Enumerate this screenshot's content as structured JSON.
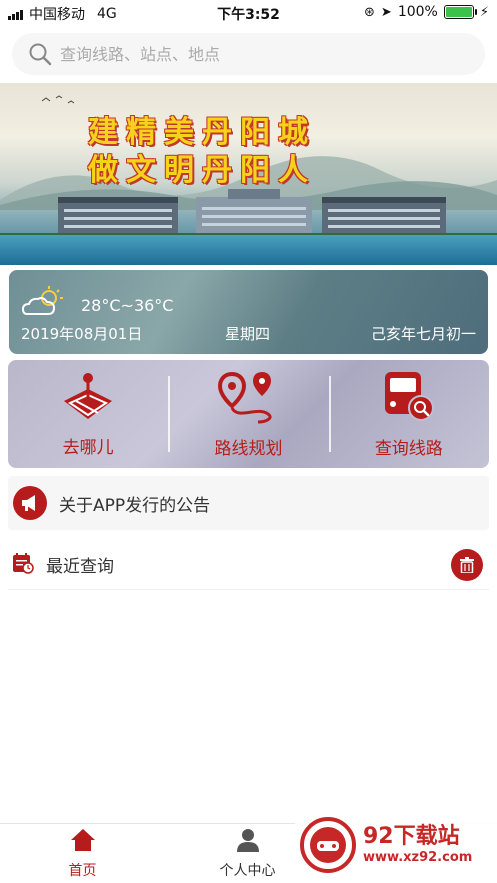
{
  "status_bar": {
    "carrier": "中国移动",
    "network": "4G",
    "time": "下午3:52",
    "battery": "100%"
  },
  "search": {
    "placeholder": "查询线路、站点、地点"
  },
  "banner": {
    "line1": "建精美丹阳城",
    "line2": "做文明丹阳人"
  },
  "weather": {
    "temperature": "28°C~36°C",
    "date": "2019年08月01日",
    "weekday": "星期四",
    "lunar_date": "己亥年七月初一",
    "icon": "partly-cloudy-icon"
  },
  "actions": [
    {
      "label": "去哪儿",
      "icon": "map-pin-icon"
    },
    {
      "label": "路线规划",
      "icon": "route-icon"
    },
    {
      "label": "查询线路",
      "icon": "bus-search-icon"
    }
  ],
  "notice": {
    "text": "关于APP发行的公告",
    "icon": "megaphone-icon"
  },
  "recent": {
    "title": "最近查询",
    "icon": "calendar-icon",
    "clear_icon": "trash-icon"
  },
  "tabbar": {
    "home": "首页",
    "profile": "个人中心"
  },
  "watermark": {
    "brand": "92下载站",
    "url": "www.xz92.com"
  },
  "colors": {
    "accent": "#b71c1c",
    "weather_bg": "#6f8f96",
    "actions_bg": "#bdbccf"
  }
}
